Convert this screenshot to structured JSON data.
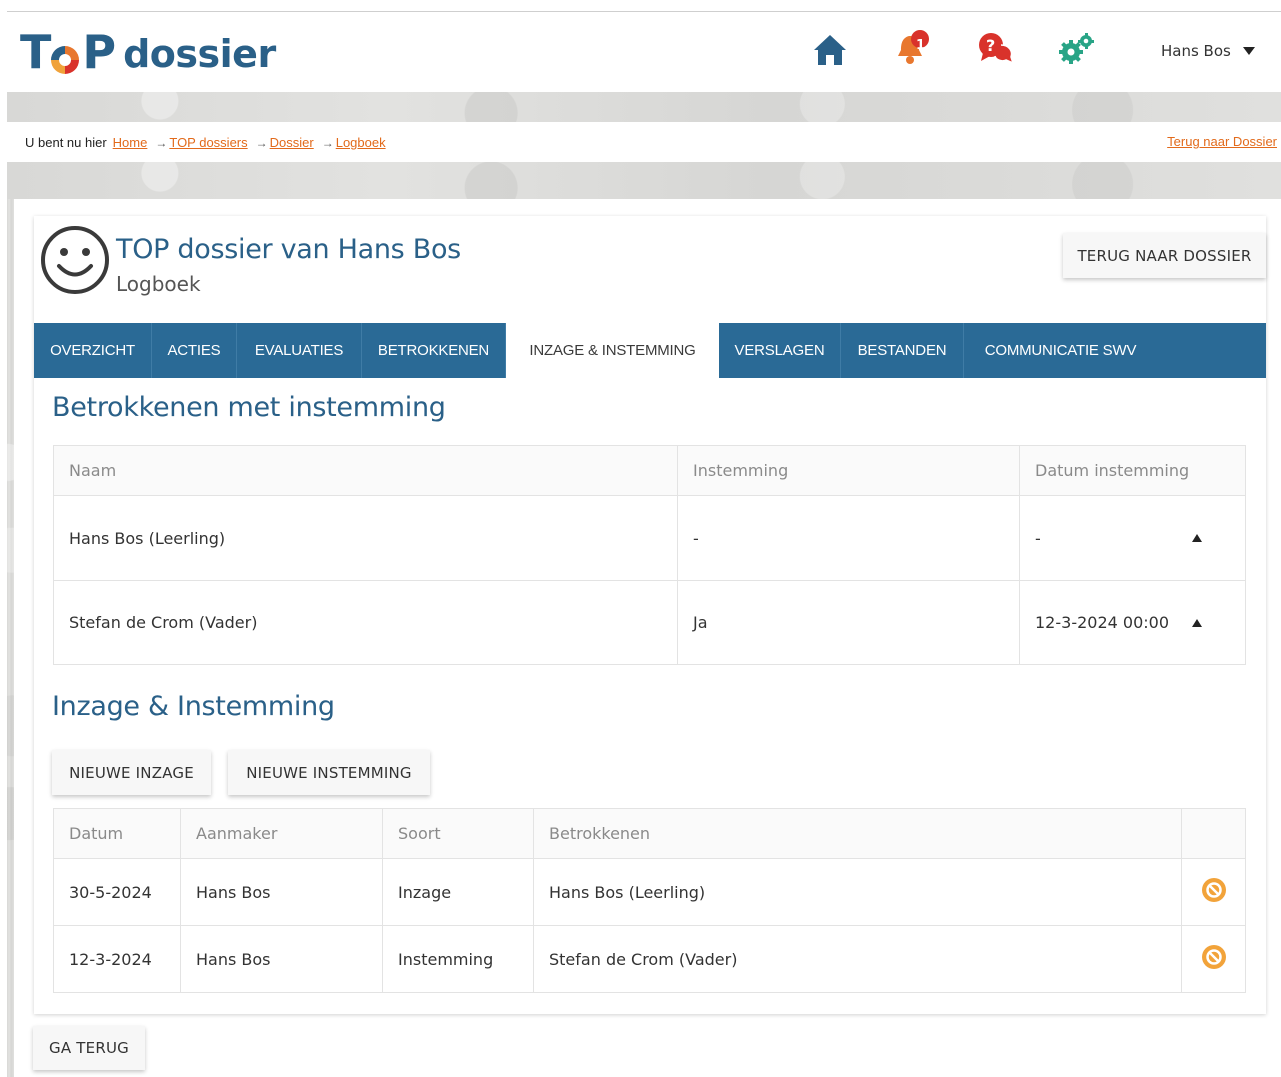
{
  "header": {
    "logo_text": "TOP",
    "logo_word": "dossier",
    "notification_count": "1",
    "user_name": "Hans Bos",
    "colors": {
      "brand_blue": "#2a6088",
      "accent_orange": "#e26a1b",
      "alert_red": "#d9322b",
      "gear_green": "#28a486"
    }
  },
  "breadcrumb": {
    "prefix": "U bent nu hier",
    "items": [
      "Home",
      "TOP dossiers",
      "Dossier",
      "Logboek"
    ],
    "back_link": "Terug naar Dossier"
  },
  "page": {
    "title": "TOP dossier van Hans Bos",
    "subtitle": "Logboek",
    "back_button": "TERUG NAAR DOSSIER"
  },
  "tabs": [
    {
      "label": "OVERZICHT",
      "active": false
    },
    {
      "label": "ACTIES",
      "active": false
    },
    {
      "label": "EVALUATIES",
      "active": false
    },
    {
      "label": "BETROKKENEN",
      "active": false
    },
    {
      "label": "INZAGE & INSTEMMING",
      "active": true
    },
    {
      "label": "VERSLAGEN",
      "active": false
    },
    {
      "label": "BESTANDEN",
      "active": false
    },
    {
      "label": "COMMUNICATIE SWV",
      "active": false
    }
  ],
  "consent_section": {
    "title": "Betrokkenen met instemming",
    "columns": [
      "Naam",
      "Instemming",
      "Datum instemming"
    ],
    "rows": [
      {
        "naam": "Hans Bos (Leerling)",
        "instemming": "-",
        "datum": "-"
      },
      {
        "naam": "Stefan de Crom (Vader)",
        "instemming": "Ja",
        "datum": "12-3-2024 00:00"
      }
    ]
  },
  "log_section": {
    "title": "Inzage & Instemming",
    "new_view_button": "NIEUWE INZAGE",
    "new_consent_button": "NIEUWE INSTEMMING",
    "columns": [
      "Datum",
      "Aanmaker",
      "Soort",
      "Betrokkenen"
    ],
    "rows": [
      {
        "datum": "30-5-2024",
        "aanmaker": "Hans Bos",
        "soort": "Inzage",
        "betrokkenen": "Hans Bos (Leerling)",
        "action_icon": "delete-icon"
      },
      {
        "datum": "12-3-2024",
        "aanmaker": "Hans Bos",
        "soort": "Instemming",
        "betrokkenen": "Stefan de Crom (Vader)",
        "action_icon": "delete-icon"
      }
    ]
  },
  "footer": {
    "back_button": "GA TERUG"
  }
}
